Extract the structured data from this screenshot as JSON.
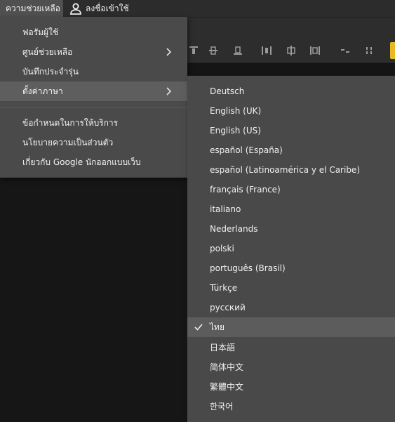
{
  "menubar": {
    "help_label": "ความช่วยเหลือ",
    "signin_label": "ลงชื่อเข้าใช้"
  },
  "help_menu": {
    "items": [
      {
        "label": "ฟอรัมผู้ใช้"
      },
      {
        "label": "ศูนย์ช่วยเหลือ"
      },
      {
        "label": "บันทึกประจำรุ่น"
      },
      {
        "label": "ตั้งค่าภาษา"
      },
      {
        "label": "ข้อกำหนดในการให้บริการ"
      },
      {
        "label": "นโยบายความเป็นส่วนตัว"
      },
      {
        "label": "เกี่ยวกับ Google นักออกแบบเว็บ"
      }
    ]
  },
  "language_menu": {
    "selected": "ไทย",
    "items": [
      "Deutsch",
      "English (UK)",
      "English (US)",
      "español (España)",
      "español (Latinoamérica y el Caribe)",
      "français (France)",
      "italiano",
      "Nederlands",
      "polski",
      "português (Brasil)",
      "Türkçe",
      "русский",
      "ไทย",
      "日本語",
      "简体中文",
      "繁體中文",
      "한국어"
    ]
  },
  "colors": {
    "menu_bg": "#4a4a4a",
    "highlight": "#5e5e5e",
    "accent": "#e8b923"
  }
}
